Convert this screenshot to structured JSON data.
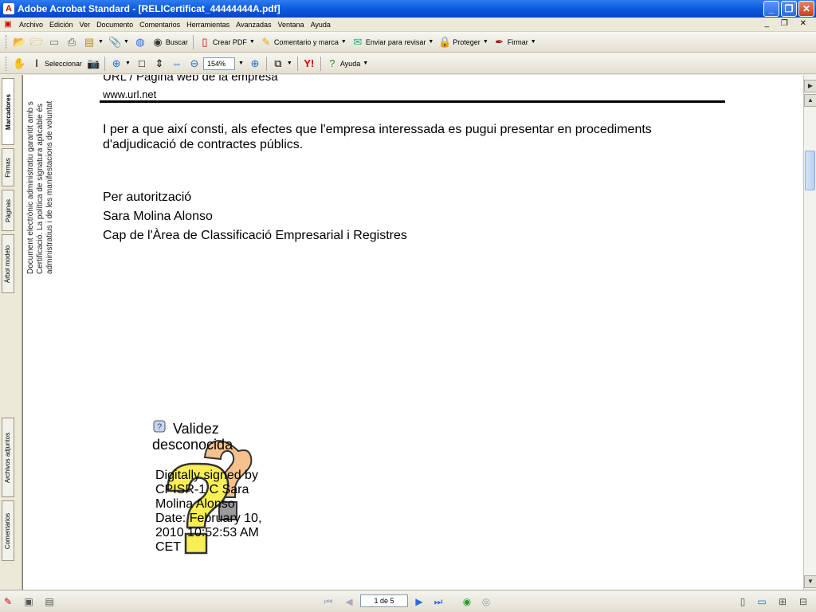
{
  "window": {
    "title": "Adobe Acrobat Standard - [RELICertificat_44444444A.pdf]"
  },
  "menu": [
    "Archivo",
    "Edición",
    "Ver",
    "Documento",
    "Comentarios",
    "Herramientas",
    "Avanzadas",
    "Ventana",
    "Ayuda"
  ],
  "toolbar1": {
    "search_label": "Buscar",
    "create_pdf_label": "Crear PDF",
    "comment_label": "Comentario y marca",
    "send_review_label": "Enviar para revisar",
    "protect_label": "Proteger",
    "sign_label": "Firmar"
  },
  "toolbar2": {
    "select_label": "Seleccionar",
    "zoom_value": "154%",
    "help_label": "Ayuda"
  },
  "side_tabs": {
    "bookmarks": "Marcadores",
    "signatures": "Firmas",
    "pages": "Páginas",
    "model_tree": "Árbol modelo",
    "attachments": "Archivos adjuntos",
    "comments": "Comentarios"
  },
  "document": {
    "side_note": [
      "Document electrònic administratiu garantit amb s",
      "Certificació. La política de signatura aplicable és",
      "administratius i de les manifestacions de voluntat"
    ],
    "url_heading": "URL / Pàgina web de la empresa",
    "url_value": "www.url.net",
    "paragraph_line1": "I per a que així consti, als efectes que l'empresa interessada es pugui presentar en procediments",
    "paragraph_line2": "d'adjudicació de contractes públics.",
    "sign_line1": "Per autorització",
    "sign_line2": "Sara Molina Alonso",
    "sign_line3": "Cap de l'Àrea de Classificació Empresarial i Registres",
    "signature": {
      "validity_line1": "Validez",
      "validity_line2": "desconocida",
      "details": [
        "Digitally signed by",
        "CPISR-1 C Sara",
        "Molina Alonso",
        "Date: February 10,",
        "2010 10:52:53 AM",
        "CET"
      ]
    }
  },
  "status": {
    "page_field": "1 de 5"
  }
}
